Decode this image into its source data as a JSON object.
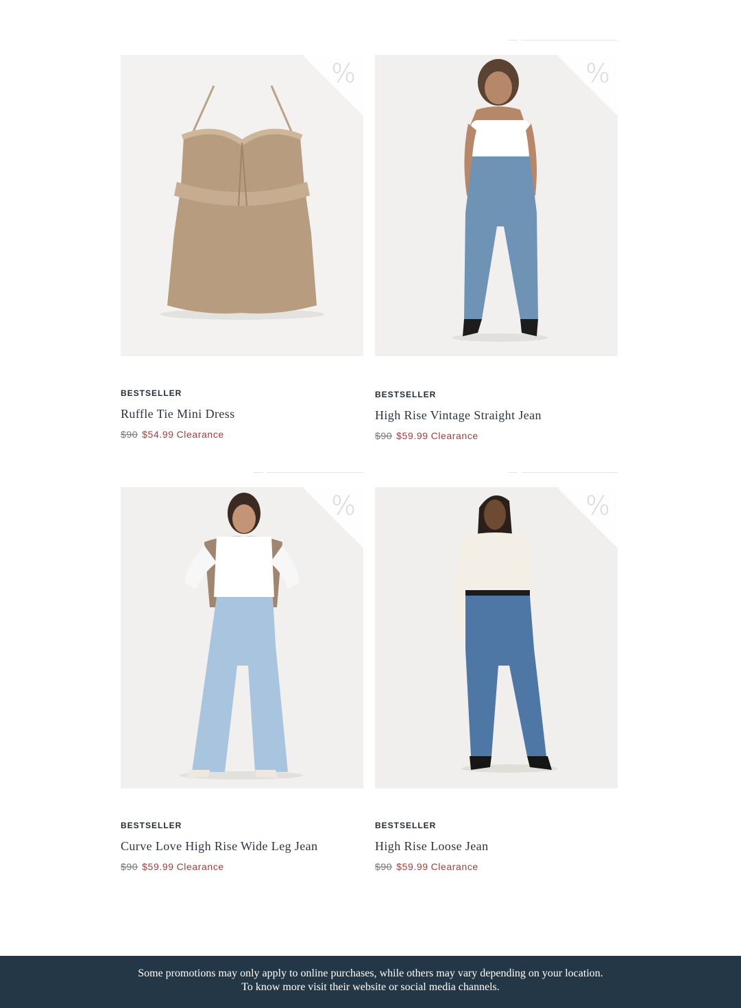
{
  "products": [
    {
      "badge": "BESTSELLER",
      "name": "Ruffle Tie Mini Dress",
      "original_price": "$90",
      "sale_price": "$54.99",
      "sale_label": "Clearance",
      "discount_icon": "%"
    },
    {
      "badge": "BESTSELLER",
      "name": "High Rise Vintage Straight Jean",
      "original_price": "$90",
      "sale_price": "$59.99",
      "sale_label": "Clearance",
      "discount_icon": "%"
    },
    {
      "badge": "BESTSELLER",
      "name": "Curve Love High Rise Wide Leg Jean",
      "original_price": "$90",
      "sale_price": "$59.99",
      "sale_label": "Clearance",
      "discount_icon": "%"
    },
    {
      "badge": "BESTSELLER",
      "name": "High Rise Loose Jean",
      "original_price": "$90",
      "sale_price": "$59.99",
      "sale_label": "Clearance",
      "discount_icon": "%"
    }
  ],
  "footer": {
    "line1": "Some promotions may only apply to online purchases, while others may vary depending on your location.",
    "line2": "To know more visit their website or social media channels."
  },
  "colors": {
    "badge": "#1f2a36",
    "sale": "#a53c3a",
    "footer_bg": "#243746",
    "image_bg": "#f1f0ee"
  }
}
